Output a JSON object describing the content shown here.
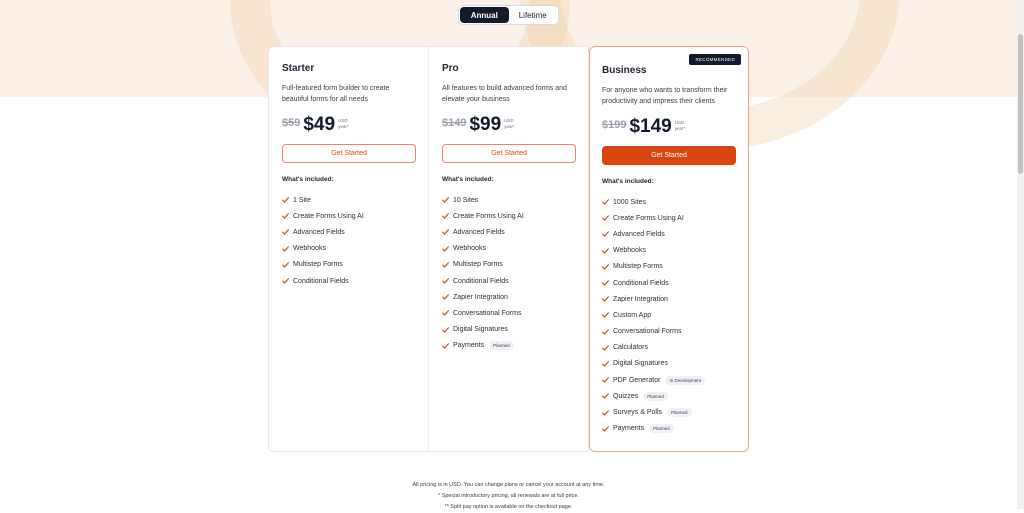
{
  "billing_toggle": {
    "annual": "Annual",
    "lifetime": "Lifetime"
  },
  "accent_color": "#d8460f",
  "plans": [
    {
      "name": "Starter",
      "description": "Full-featured form builder to create beautiful forms for all needs",
      "old_price": "$59",
      "price": "$49",
      "currency": "USD",
      "period": "year*",
      "cta": "Get Started",
      "included_heading": "What's included:",
      "features": [
        {
          "label": "1 Site",
          "tag": ""
        },
        {
          "label": "Create Forms Using AI",
          "tag": ""
        },
        {
          "label": "Advanced Fields",
          "tag": ""
        },
        {
          "label": "Webhooks",
          "tag": ""
        },
        {
          "label": "Multistep Forms",
          "tag": ""
        },
        {
          "label": "Conditional Fields",
          "tag": ""
        }
      ]
    },
    {
      "name": "Pro",
      "description": "All features to build advanced forms and elevate your business",
      "old_price": "$149",
      "price": "$99",
      "currency": "USD",
      "period": "year*",
      "cta": "Get Started",
      "included_heading": "What's included:",
      "features": [
        {
          "label": "10 Sites",
          "tag": ""
        },
        {
          "label": "Create Forms Using AI",
          "tag": ""
        },
        {
          "label": "Advanced Fields",
          "tag": ""
        },
        {
          "label": "Webhooks",
          "tag": ""
        },
        {
          "label": "Multistep Forms",
          "tag": ""
        },
        {
          "label": "Conditional Fields",
          "tag": ""
        },
        {
          "label": "Zapier Integration",
          "tag": ""
        },
        {
          "label": "Conversational Forms",
          "tag": ""
        },
        {
          "label": "Digital Signatures",
          "tag": ""
        },
        {
          "label": "Payments",
          "tag": "Planned"
        }
      ]
    },
    {
      "name": "Business",
      "badge": "RECOMMENDED",
      "description": "For anyone who wants to transform their productivity and impress their clients",
      "old_price": "$199",
      "price": "$149",
      "currency": "USD",
      "period": "year*",
      "cta": "Get Started",
      "included_heading": "What's included:",
      "features": [
        {
          "label": "1000 Sites",
          "tag": ""
        },
        {
          "label": "Create Forms Using AI",
          "tag": ""
        },
        {
          "label": "Advanced Fields",
          "tag": ""
        },
        {
          "label": "Webhooks",
          "tag": ""
        },
        {
          "label": "Multistep Forms",
          "tag": ""
        },
        {
          "label": "Conditional Fields",
          "tag": ""
        },
        {
          "label": "Zapier Integration",
          "tag": ""
        },
        {
          "label": "Custom App",
          "tag": ""
        },
        {
          "label": "Conversational Forms",
          "tag": ""
        },
        {
          "label": "Calculators",
          "tag": ""
        },
        {
          "label": "Digital Signatures",
          "tag": ""
        },
        {
          "label": "PDF Generator",
          "tag": "In Development"
        },
        {
          "label": "Quizzes",
          "tag": "Planned"
        },
        {
          "label": "Surveys & Polls",
          "tag": "Planned"
        },
        {
          "label": "Payments",
          "tag": "Planned"
        }
      ]
    }
  ],
  "footer": {
    "note1": "All pricing is in USD. You can change plans or cancel your account at any time.",
    "note2": "* Special introductory pricing, all renewals are at full price.",
    "note3": "** Split pay option is available on the checkout page."
  }
}
